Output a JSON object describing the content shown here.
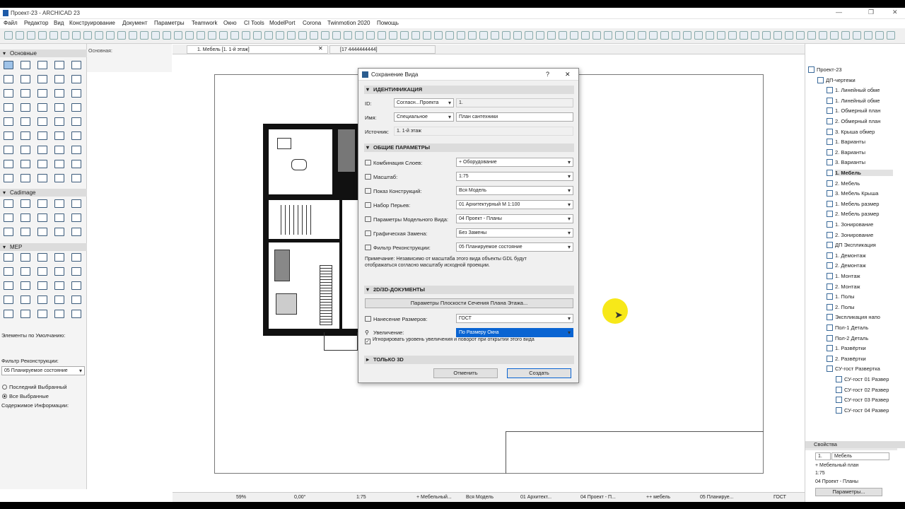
{
  "app": {
    "title": "Проект-23 - ARCHICAD 23",
    "min": "—",
    "max": "❐",
    "close": "✕"
  },
  "menu": [
    "Файл",
    "Редактор",
    "Вид",
    "Конструирование",
    "Документ",
    "Параметры",
    "Teamwork",
    "Окно",
    "CI Tools",
    "ModelPort",
    "Corona",
    "Twinmotion 2020",
    "Помощь"
  ],
  "left": {
    "section_main": "Основные",
    "mid_label": "Основная:",
    "section_cadimage": "Cadimage",
    "section_mep": "MEP",
    "defaults_label": "Элементы по Умолчанию:",
    "reno_filter_label": "Фильтр Реконструкции:",
    "reno_filter_value": "05 Планируемое состояние",
    "radio_last": "Последний Выбранный",
    "radio_all": "Все Выбранные",
    "info_label": "Содержимое Информации:"
  },
  "tabs": {
    "tab1": "1. Мебель [1. 1-й этаж]",
    "tab2": "[17 4444444444]"
  },
  "dialog": {
    "title": "Сохранение Вида",
    "help": "?",
    "close": "✕",
    "sec_ident": "ИДЕНТИФИКАЦИЯ",
    "id_label": "ID:",
    "id_select": "Согласн...Проекта",
    "id_value": "1.",
    "name_label": "Имя:",
    "name_select": "Специальное",
    "name_value": "План сантехники",
    "source_label": "Источник:",
    "source_value": "1. 1-й этаж",
    "sec_general": "ОБЩИЕ ПАРАМЕТРЫ",
    "params": [
      {
        "label": "Комбинация Слоев:",
        "value": "+ Оборудование"
      },
      {
        "label": "Масштаб:",
        "value": "1:75"
      },
      {
        "label": "Показ Конструкций:",
        "value": "Вся Модель"
      },
      {
        "label": "Набор Перьев:",
        "value": "01 Архитектурный М 1:100"
      },
      {
        "label": "Параметры Модельного Вида:",
        "value": "04 Проект - Планы"
      },
      {
        "label": "Графическая Замена:",
        "value": "Без Замены"
      },
      {
        "label": "Фильтр Реконструкции:",
        "value": "05 Планируемое состояние"
      }
    ],
    "note": "Примечание: Независимо от масштаба этого вида объекты GDL будут отображаться согласно масштабу исходной проекции.",
    "sec_2d3d": "2D/3D-ДОКУМЕНТЫ",
    "section_plane_btn": "Параметры Плоскости Сечения Плана Этажа...",
    "dims_label": "Нанесение Размеров:",
    "dims_value": "ГОСТ",
    "zoom_label": "Увеличение:",
    "zoom_value": "По Размеру Окна",
    "ignore_check": "Игнорировать уровень увеличения и поворот при открытии этого вида",
    "sec_3d": "ТОЛЬКО 3D",
    "cancel": "Отменить",
    "create": "Создать"
  },
  "tree": {
    "items": [
      {
        "label": "Проект-23",
        "level": 0
      },
      {
        "label": "ДП-чертежи",
        "level": 1
      },
      {
        "label": "1. Линейный обме",
        "level": 2
      },
      {
        "label": "1. Линейный обме",
        "level": 2
      },
      {
        "label": "1. Обмерный план",
        "level": 2
      },
      {
        "label": "2. Обмерный план",
        "level": 2
      },
      {
        "label": "3. Крыша обмер",
        "level": 2
      },
      {
        "label": "1. Варианты",
        "level": 2
      },
      {
        "label": "2. Варианты",
        "level": 2
      },
      {
        "label": "3. Варианты",
        "level": 2
      },
      {
        "label": "1. Мебель",
        "level": 2,
        "selected": true
      },
      {
        "label": "2. Мебель",
        "level": 2
      },
      {
        "label": "3. Мебель Крыша",
        "level": 2
      },
      {
        "label": "1. Мебель размер",
        "level": 2
      },
      {
        "label": "2. Мебель размер",
        "level": 2
      },
      {
        "label": "1. Зонирование",
        "level": 2
      },
      {
        "label": "2. Зонирование",
        "level": 2
      },
      {
        "label": "ДП Экспликация",
        "level": 2
      },
      {
        "label": "1. Демонтаж",
        "level": 2
      },
      {
        "label": "2. Демонтаж",
        "level": 2
      },
      {
        "label": "1. Монтаж",
        "level": 2
      },
      {
        "label": "2. Монтаж",
        "level": 2
      },
      {
        "label": "1. Полы",
        "level": 2
      },
      {
        "label": "2. Полы",
        "level": 2
      },
      {
        "label": "Экспликация напо",
        "level": 2
      },
      {
        "label": "Пол-1 Деталь",
        "level": 2
      },
      {
        "label": "Пол-2 Деталь",
        "level": 2
      },
      {
        "label": "1. Развёртки",
        "level": 2
      },
      {
        "label": "2. Развёртки",
        "level": 2
      },
      {
        "label": "СУ-гост  Развертка",
        "level": 2
      },
      {
        "label": "СУ-гост 01 Развер",
        "level": 3
      },
      {
        "label": "СУ-гост 02 Развер",
        "level": 3
      },
      {
        "label": "СУ-гост 03 Развер",
        "level": 3
      },
      {
        "label": "СУ-гост 04 Развер",
        "level": 3
      }
    ]
  },
  "props": {
    "header": "Свойства",
    "id": "1.",
    "name": "Мебель",
    "layer": "+ Мебельный план",
    "scale": "1:75",
    "mvo": "04 Проект - Планы",
    "button": "Параметры..."
  },
  "status": {
    "zoom": "59%",
    "angle": "0,00°",
    "scale": "1:75",
    "layers": "+ Мебельный...",
    "structure": "Вся Модель",
    "pens": "01 Архитект...",
    "mvo": "04 Проект - П...",
    "override": "++ мебель",
    "reno": "05 Планируе...",
    "dims": "ГОСТ"
  }
}
